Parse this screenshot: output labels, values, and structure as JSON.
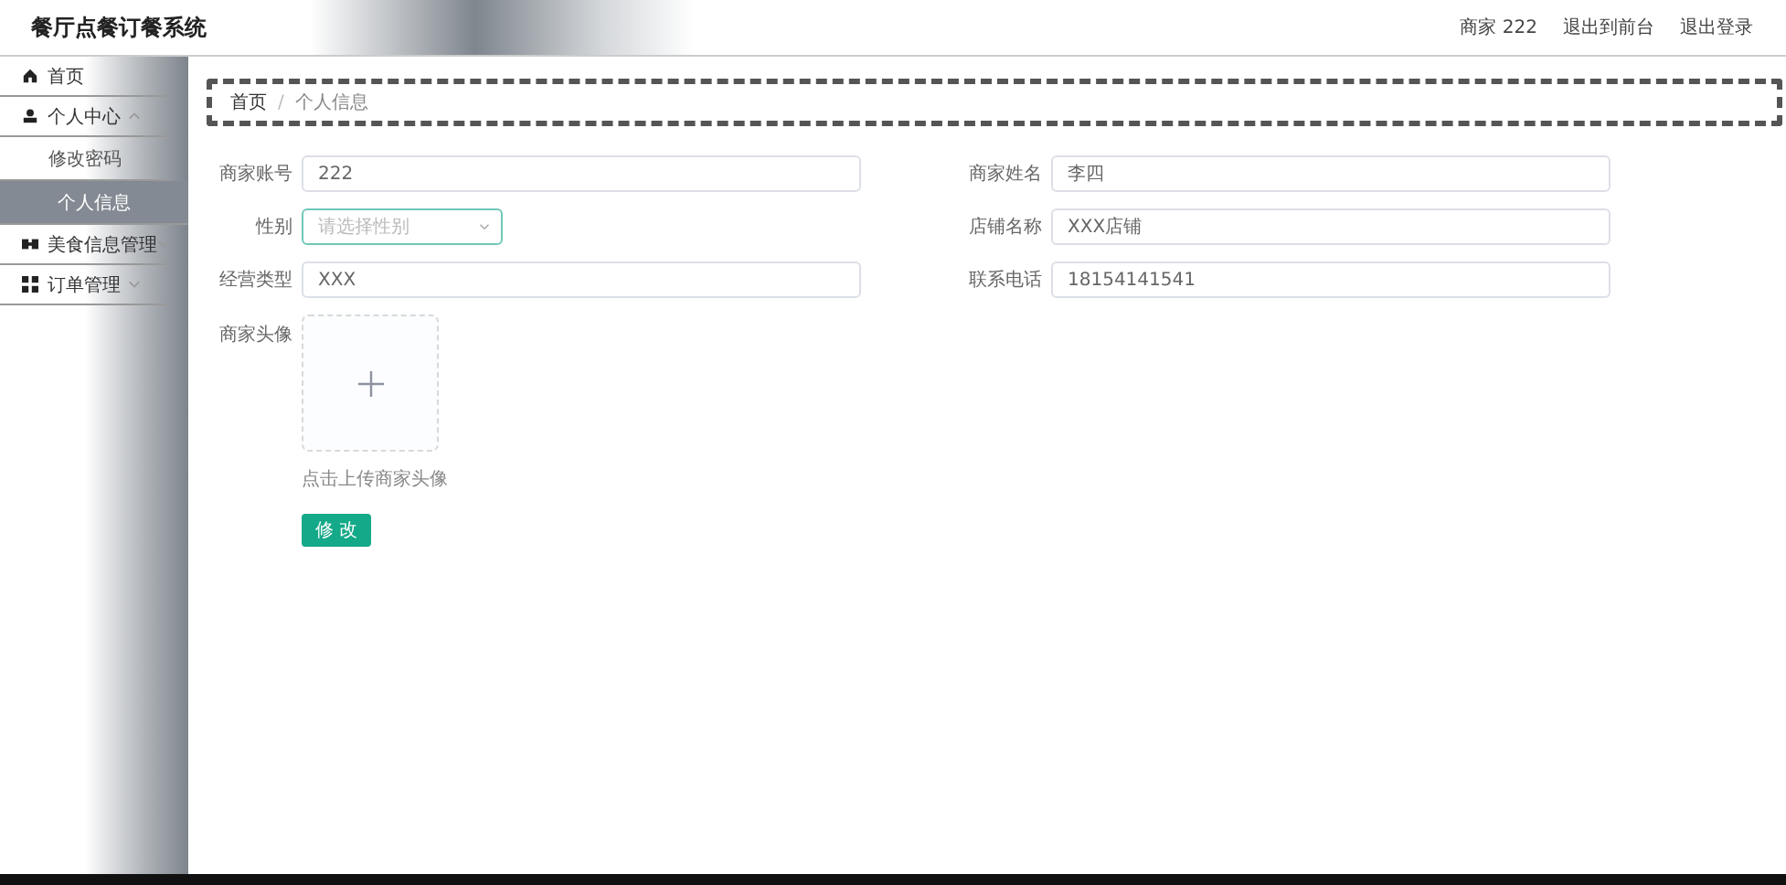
{
  "header": {
    "title": "餐厅点餐订餐系统",
    "user": "商家 222",
    "links": [
      "退出到前台",
      "退出登录"
    ]
  },
  "sidebar": {
    "items": [
      {
        "label": "首页",
        "selected": false
      },
      {
        "label": "个人中心",
        "selected": false,
        "expanded": true,
        "children": [
          {
            "label": "修改密码",
            "selected": false
          },
          {
            "label": "个人信息",
            "selected": true
          }
        ]
      },
      {
        "label": "美食信息管理",
        "selected": false,
        "expanded": false
      },
      {
        "label": "订单管理",
        "selected": false,
        "expanded": false
      }
    ]
  },
  "breadcrumb": {
    "items": [
      "首页",
      "个人信息"
    ],
    "separator": "/"
  },
  "form": {
    "fields": [
      {
        "label": "商家账号",
        "value": "222",
        "kind": "text"
      },
      {
        "label": "商家姓名",
        "value": "李四",
        "kind": "text"
      },
      {
        "label": "性别",
        "placeholder": "请选择性别",
        "kind": "select",
        "focused": true
      },
      {
        "label": "店铺名称",
        "value": "XXX店铺",
        "kind": "text"
      },
      {
        "label": "经营类型",
        "value": "XXX",
        "kind": "text"
      },
      {
        "label": "联系电话",
        "value": "18154141541",
        "kind": "text"
      }
    ],
    "avatar": {
      "label": "商家头像",
      "hint": "点击上传商家头像"
    },
    "submit": "修 改"
  }
}
